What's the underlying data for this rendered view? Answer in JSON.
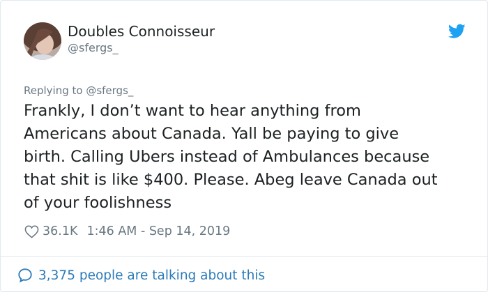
{
  "author": {
    "display_name": "Doubles Connoisseur",
    "handle": "@sfergs_",
    "avatar_icon": "avatar-photo"
  },
  "header": {
    "brand_icon": "twitter-bird-icon",
    "brand_color": "#1da1f2"
  },
  "tweet": {
    "reply_to": "Replying to @sfergs_",
    "text": "Frankly, I don’t want to hear anything from\nAmericans about Canada. Yall be paying to give\nbirth. Calling Ubers instead of Ambulances because\nthat shit is like $400. Please. Abeg leave Canada out\nof your foolishness",
    "likes": "36.1K",
    "timestamp": "1:46 AM - Sep 14, 2019"
  },
  "footer": {
    "talking_label": "3,375 people are talking about this",
    "link_color": "#2b7bb9"
  }
}
